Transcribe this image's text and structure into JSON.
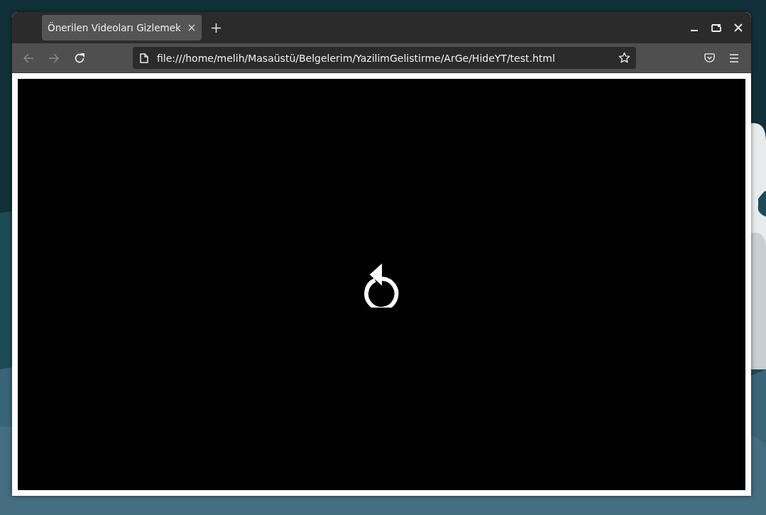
{
  "tabs": [
    {
      "title": "Önerilen Videoları Gizlemek",
      "selected": true
    }
  ],
  "navigation": [
    {
      "kind": "back",
      "disabled": true
    },
    {
      "kind": "forward",
      "disabled": true
    },
    {
      "kind": "reload",
      "disabled": false
    }
  ],
  "address_bar": {
    "url": "file:///home/melih/Masaüstü/Belgelerim/YazilimGelistirme/ArGe/HideYT/test.html"
  }
}
